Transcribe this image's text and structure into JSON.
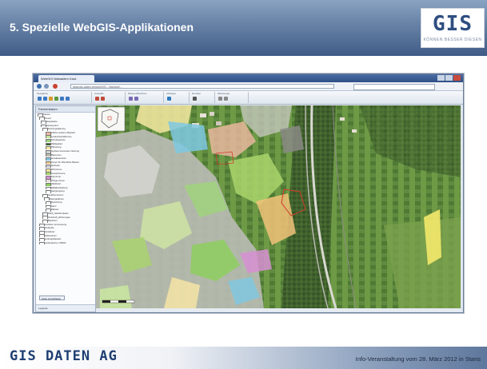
{
  "slide": {
    "title": "5. Spezielle WebGIS-Applikationen",
    "logo": {
      "text": "GIS",
      "tagline": "KÖNNEN BESSER DIESEN"
    },
    "footer": {
      "brand": "GIS DATEN AG",
      "event": "Info-Veranstaltung vom 28. März 2012 in Stans"
    }
  },
  "colors": {
    "header_top": "#8aa3c2",
    "header_bottom": "#3f5c86",
    "brand_blue": "#1f3f72",
    "logo_blue": "#2e4e80"
  },
  "browser": {
    "tab_title": "WebGIS Nidwalden Kant.",
    "url": "www.gis-daten.ch/webGIS/.../nw/kant/...",
    "toolbar_groups": [
      "Navigation",
      "Auswahl",
      "Messen/Zeichnen",
      "Abfragen",
      "Drucken",
      "Werkzeuge"
    ],
    "sidebar": {
      "header": "Themenbaum",
      "layers": [
        "Kanton",
        "Grund",
        "Hauptkarte",
        "Hintergrund",
        "Nutzungsplanung",
        "Fläche anderen Baufeld",
        "Landwirtschaftszone",
        "Schutzgebiete",
        "Waldgebiet",
        "Pflanzung",
        "Gebiete besondere Nutzung",
        "Bauzonen",
        "Gewässerraum",
        "Zonen für öffentliche Bauten",
        "Strassen",
        "Wohnzone",
        "Gewerbezone",
        "Kernzone",
        "Übrige Zonen",
        "Waldrand",
        "Waldfeststellung",
        "Hangneigung",
        "Gefahrenzonen",
        "Naturgefahren",
        "Rutschung",
        "Sturz",
        "Wasser",
        "Wald_Gefahrenkarte",
        "Ortschaft_Wohnungen",
        "Baulinien",
        "Amtliche Vermessung",
        "Gebäude",
        "Gewässer",
        "Höhenlinien",
        "Leitungskataster",
        "Landeskarte 1:25000"
      ],
      "button": "Karte zurückholen",
      "footer": "Legende"
    }
  }
}
